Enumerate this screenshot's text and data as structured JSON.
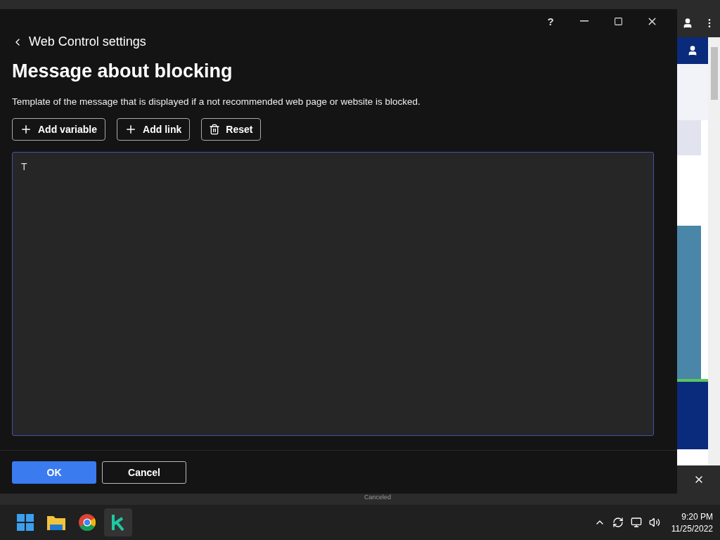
{
  "dialog": {
    "help": "?",
    "back_label": "Web Control settings",
    "title": "Message about blocking",
    "description": "Template of the message that is displayed if a not recommended web page or website is blocked.",
    "tools": [
      {
        "label": "Add variable",
        "kind": "add"
      },
      {
        "label": "Add link",
        "kind": "add"
      },
      {
        "label": "Reset",
        "kind": "delete"
      }
    ],
    "editor": {
      "value": "T"
    },
    "ok": "OK",
    "cancel": "Cancel"
  },
  "background": {
    "status": "Canceled"
  },
  "taskbar": {
    "apps": [
      {
        "kind": "start",
        "selected": false
      },
      {
        "kind": "files",
        "selected": false
      },
      {
        "kind": "chrome",
        "selected": false
      },
      {
        "kind": "k",
        "selected": true
      }
    ],
    "time": "9:20 PM",
    "date": "11/25/2022"
  }
}
